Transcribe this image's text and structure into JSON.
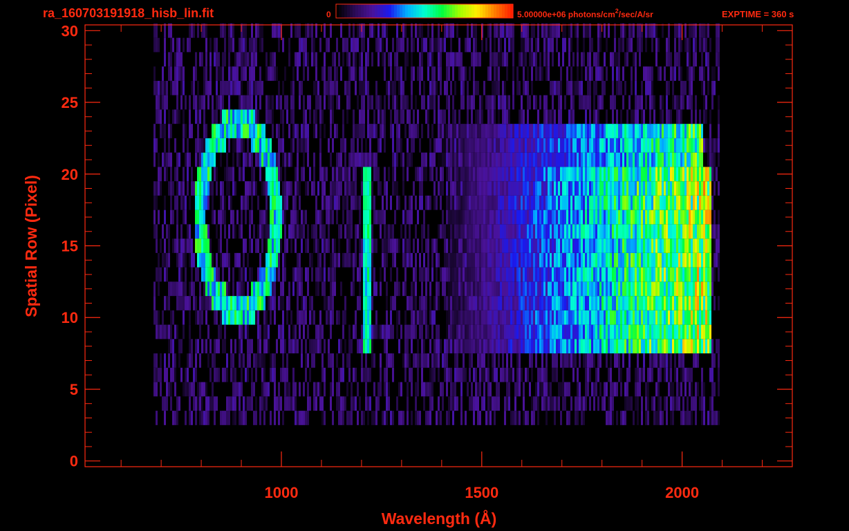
{
  "header": {
    "filename": "ra_160703191918_hisb_lin.fit",
    "colorbar_min_label": "0",
    "colorbar_max_label_prefix": "5.00000e+06 photons/cm",
    "colorbar_max_label_sup": "2",
    "colorbar_max_label_suffix": "/sec/A/sr",
    "exptime_label": "EXPTIME = 360 s"
  },
  "colors": {
    "background": "#000000",
    "axis": "#ff2a10",
    "text": "#ff2a10"
  },
  "colormap": [
    "#000000",
    "#2a0a55",
    "#4a1299",
    "#1a1aee",
    "#00b0ff",
    "#00ffd0",
    "#00ff40",
    "#a0ff00",
    "#ffee00",
    "#ff8000",
    "#ff2000"
  ],
  "chart_data": {
    "type": "heatmap",
    "title": "",
    "xlabel": "Wavelength (Å)",
    "ylabel": "Spatial Row (Pixel)",
    "xlim": [
      510,
      2275
    ],
    "ylim": [
      -0.4,
      30.4
    ],
    "x_ticks": [
      1000,
      1500,
      2000
    ],
    "y_ticks": [
      0,
      5,
      10,
      15,
      20,
      25,
      30
    ],
    "x_tick_labels": [
      "1000",
      "1500",
      "2000"
    ],
    "y_tick_labels": [
      "0",
      "5",
      "10",
      "15",
      "20",
      "25",
      "30"
    ],
    "x_minor_ticks": [
      600,
      700,
      800,
      900,
      1100,
      1200,
      1300,
      1400,
      1600,
      1700,
      1800,
      1900,
      2100,
      2200
    ],
    "y_minor_ticks": [
      1,
      2,
      3,
      4,
      6,
      7,
      8,
      9,
      11,
      12,
      13,
      14,
      16,
      17,
      18,
      19,
      21,
      22,
      23,
      24,
      26,
      27,
      28,
      29
    ],
    "colorbar": {
      "min": 0,
      "max": 5000000,
      "units": "photons/cm^2/sec/A/sr"
    },
    "features": [
      {
        "label": "ring",
        "center_x": 890,
        "center_y": 17,
        "radius_x": 95,
        "radius_y": 6.5,
        "intensity": 0.55
      },
      {
        "label": "line",
        "x": 1210,
        "y_range": [
          8,
          20
        ],
        "intensity": 0.55
      },
      {
        "label": "continuum",
        "x_range": [
          1400,
          2070
        ],
        "y_range": [
          8,
          20
        ],
        "peak_intensity": 0.85
      },
      {
        "label": "continuum",
        "x_range": [
          1380,
          2050
        ],
        "y_range": [
          21,
          23
        ],
        "peak_intensity": 0.7
      },
      {
        "label": "noise",
        "x_range": [
          680,
          2090
        ],
        "y_range": [
          3,
          30
        ],
        "intensity": 0.2
      }
    ]
  }
}
